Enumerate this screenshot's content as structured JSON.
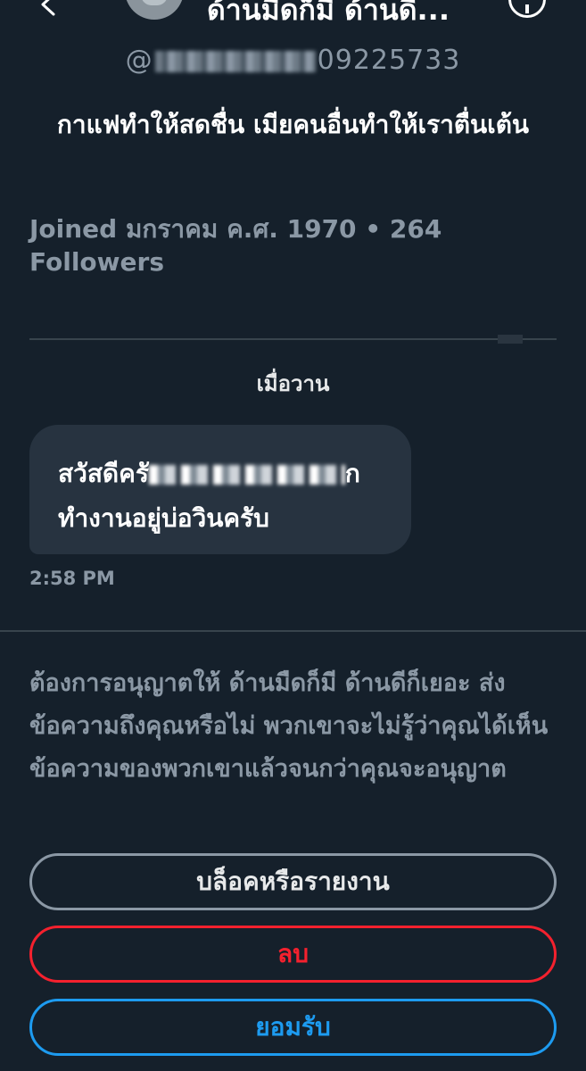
{
  "header": {
    "name": "ด้านมืดก็มี ด้านดี...",
    "back_icon": "chevron-left-icon",
    "info_icon": "info-icon"
  },
  "profile": {
    "handle_prefix": "@",
    "handle_suffix": "09225733",
    "bio": "กาแฟทำให้สดชื่น  เมียคนอื่นทำให้เราตื่นเต้น",
    "joined": "Joined มกราคม ค.ศ. 1970 • 264 Followers"
  },
  "conversation": {
    "date_label": "เมื่อวาน",
    "messages": [
      {
        "line1_start": "สวัสดีครั",
        "line1_end": "ก",
        "line2": "ทำงานอยู่บ่อวินครับ",
        "time": "2:58 PM"
      }
    ]
  },
  "request": {
    "text": "ต้องการอนุญาตให้ ด้านมืดก็มี ด้านดีก็เยอะ ส่งข้อความถึงคุณหรือไม่ พวกเขาจะไม่รู้ว่าคุณได้เห็นข้อความของพวกเขาแล้วจนกว่าคุณจะอนุญาต",
    "block_label": "บล็อคหรือรายงาน",
    "delete_label": "ลบ",
    "accept_label": "ยอมรับ"
  },
  "colors": {
    "background": "#15202b",
    "bubble": "#273340",
    "muted_text": "#8b98a5",
    "danger": "#f4212e",
    "accent": "#1d9bf0"
  }
}
